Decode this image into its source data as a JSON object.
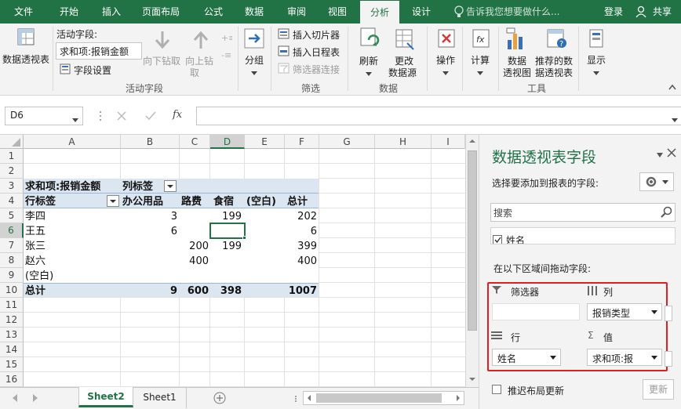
{
  "tabs": [
    {
      "label": "文件",
      "active": false
    },
    {
      "label": "开始",
      "active": false
    },
    {
      "label": "插入",
      "active": false
    },
    {
      "label": "页面布局",
      "active": false
    },
    {
      "label": "公式",
      "active": false
    },
    {
      "label": "数据",
      "active": false
    },
    {
      "label": "审阅",
      "active": false
    },
    {
      "label": "视图",
      "active": false
    },
    {
      "label": "分析",
      "active": true
    },
    {
      "label": "设计",
      "active": false
    }
  ],
  "tell_me": "告诉我您想要做什么...",
  "login": "登录",
  "share": "共享",
  "ribbon": {
    "pivot_table": "数据透视表",
    "active_field_label": "活动字段:",
    "active_field_value": "求和项:报销金额",
    "field_settings": "字段设置",
    "drill_down": "向下钻取",
    "drill_up": "向上钻",
    "drill_up2": "取",
    "group_active_field": "活动字段",
    "group_btn": "分组",
    "insert_slicer": "插入切片器",
    "insert_timeline": "插入日程表",
    "filter_connections": "筛选器连接",
    "group_filter": "筛选",
    "refresh": "刷新",
    "change_source": "更改",
    "change_source2": "数据源",
    "group_data": "数据",
    "actions": "操作",
    "calculations": "计算",
    "pivot_chart": "数据",
    "pivot_chart2": "透视图",
    "recommended": "推荐的数",
    "recommended2": "据透视表",
    "group_tools": "工具",
    "show": "显示"
  },
  "formula_bar": {
    "name_box": "D6",
    "fx": "fx",
    "formula": ""
  },
  "columns": [
    "A",
    "B",
    "C",
    "D",
    "E",
    "F",
    "G",
    "H",
    "I"
  ],
  "rows": [
    "1",
    "2",
    "3",
    "4",
    "5",
    "6",
    "7",
    "8",
    "9",
    "10",
    "11",
    "12",
    "13",
    "14",
    "15",
    "16"
  ],
  "pivot": {
    "r3_a": "求和项:报销金额",
    "r3_b": "列标签",
    "r4_a": "行标签",
    "r4_b": "办公用品",
    "r4_c": "路费",
    "r4_d": "食宿",
    "r4_e": "(空白)",
    "r4_f": "总计",
    "r5_a": "李四",
    "r5_d": "199",
    "r5_f": "202",
    "r5_b": "3",
    "r6_a": "王五",
    "r6_b": "6",
    "r6_f": "6",
    "r7_a": "张三",
    "r7_c": "200",
    "r7_d": "199",
    "r7_f": "399",
    "r8_a": "赵六",
    "r8_c": "400",
    "r8_f": "400",
    "r9_a": "(空白)",
    "r10_a": "总计",
    "r10_b": "9",
    "r10_c": "600",
    "r10_d": "398",
    "r10_f": "1007"
  },
  "sheets": [
    {
      "label": "Sheet2",
      "active": true
    },
    {
      "label": "Sheet1",
      "active": false
    }
  ],
  "panel": {
    "title": "数据透视表字段",
    "choose_fields": "选择要添加到报表的字段:",
    "search_placeholder": "搜索",
    "field_partial": "姓名",
    "drag_label": "在以下区域间拖动字段:",
    "filters": "筛选器",
    "columns": "列",
    "rows": "行",
    "values": "值",
    "column_field": "报销类型",
    "row_field": "姓名",
    "value_field": "求和项:报",
    "defer_update": "推迟布局更新",
    "update": "更新"
  },
  "colors": {
    "accent": "#217346",
    "highlight_border": "#e02020",
    "pivot_header": "#dce6f1"
  }
}
